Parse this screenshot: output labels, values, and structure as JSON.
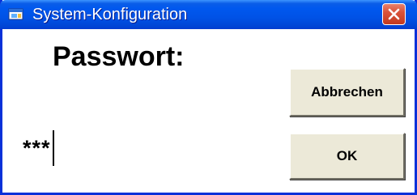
{
  "window": {
    "title": "System-Konfiguration"
  },
  "dialog": {
    "prompt_label": "Passwort:",
    "password_value": "***",
    "cancel_label": "Abbrechen",
    "ok_label": "OK"
  },
  "icons": {
    "title": "app-window-icon",
    "close": "close-icon"
  },
  "colors": {
    "titlebar": "#0058ee",
    "frame": "#0831d9",
    "close_button": "#d9533a",
    "button_face": "#ece9d8"
  }
}
